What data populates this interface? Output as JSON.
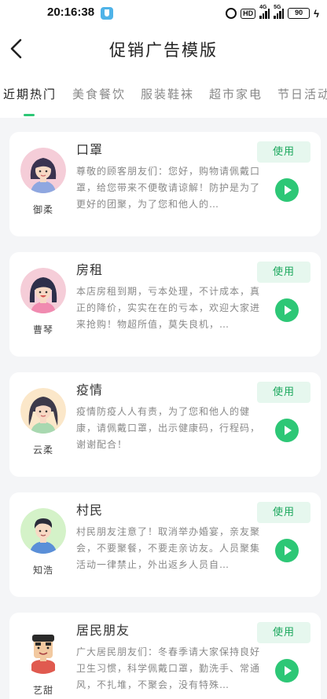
{
  "status_bar": {
    "time": "20:16:38",
    "network_1": "4G",
    "network_2": "5G",
    "hd_label": "HD",
    "battery": "90"
  },
  "header": {
    "title": "促销广告模版"
  },
  "tabs": [
    {
      "label": "近期热门",
      "active": true
    },
    {
      "label": "美食餐饮"
    },
    {
      "label": "服装鞋袜"
    },
    {
      "label": "超市家电"
    },
    {
      "label": "节日活动"
    }
  ],
  "cards": [
    {
      "title": "口罩",
      "voice_name": "御柔",
      "use_label": "使用",
      "description": "尊敬的顾客朋友们：您好，购物请佩戴口罩，给您带来不便敬请谅解！防护是为了更好的团聚，为了您和他人的…"
    },
    {
      "title": "房租",
      "voice_name": "曹琴",
      "use_label": "使用",
      "description": "本店房租到期，亏本处理，不计成本，真正的降价，实实在在的亏本，欢迎大家进来抢购！物超所值，莫失良机，…"
    },
    {
      "title": "疫情",
      "voice_name": "云柔",
      "use_label": "使用",
      "description": "疫情防疫人人有责，为了您和他人的健康，请佩戴口罩，出示健康码，行程码，谢谢配合！"
    },
    {
      "title": "村民",
      "voice_name": "知浩",
      "use_label": "使用",
      "description": "村民朋友注意了！取消举办婚宴，亲友聚会，不要聚餐，不要走亲访友。人员聚集活动一律禁止，外出返乡人员自…"
    },
    {
      "title": "居民朋友",
      "voice_name": "艺甜",
      "use_label": "使用",
      "description": "广大居民朋友们：冬春季请大家保持良好卫生习惯，科学佩戴口罩，勤洗手、常通风，不扎堆，不聚会，没有特殊…"
    }
  ],
  "colors": {
    "accent": "#2dc776",
    "use_button_bg": "#e6f7ee",
    "use_button_text": "#1aa75c",
    "page_bg": "#f4f5f7"
  }
}
